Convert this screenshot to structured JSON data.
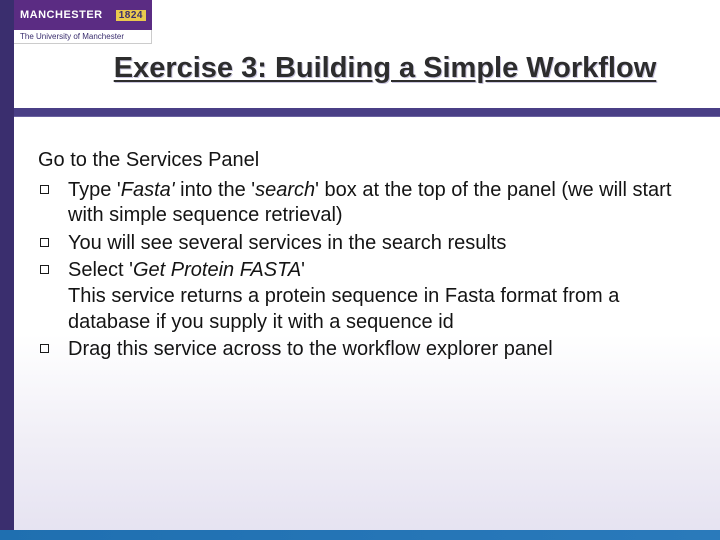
{
  "logo": {
    "brand": "MANCHESTER",
    "year": "1824",
    "sub": "The University of Manchester"
  },
  "title": "Exercise 3: Building a Simple Workflow",
  "content": {
    "intro": "Go to the Services Panel",
    "bullets": [
      {
        "pre": "Type '",
        "ital1": "Fasta'",
        "mid": " into the '",
        "ital2": "search",
        "post": "' box at the top of the panel (we will start with simple sequence retrieval)"
      },
      {
        "text": "You will see several services in the search results"
      },
      {
        "pre": "Select '",
        "ital1": "Get Protein FASTA",
        "post": "'",
        "cont": "This service returns a protein sequence in Fasta format from a database if you supply it with a sequence id"
      },
      {
        "text": "Drag this service across to the workflow explorer panel"
      }
    ]
  }
}
